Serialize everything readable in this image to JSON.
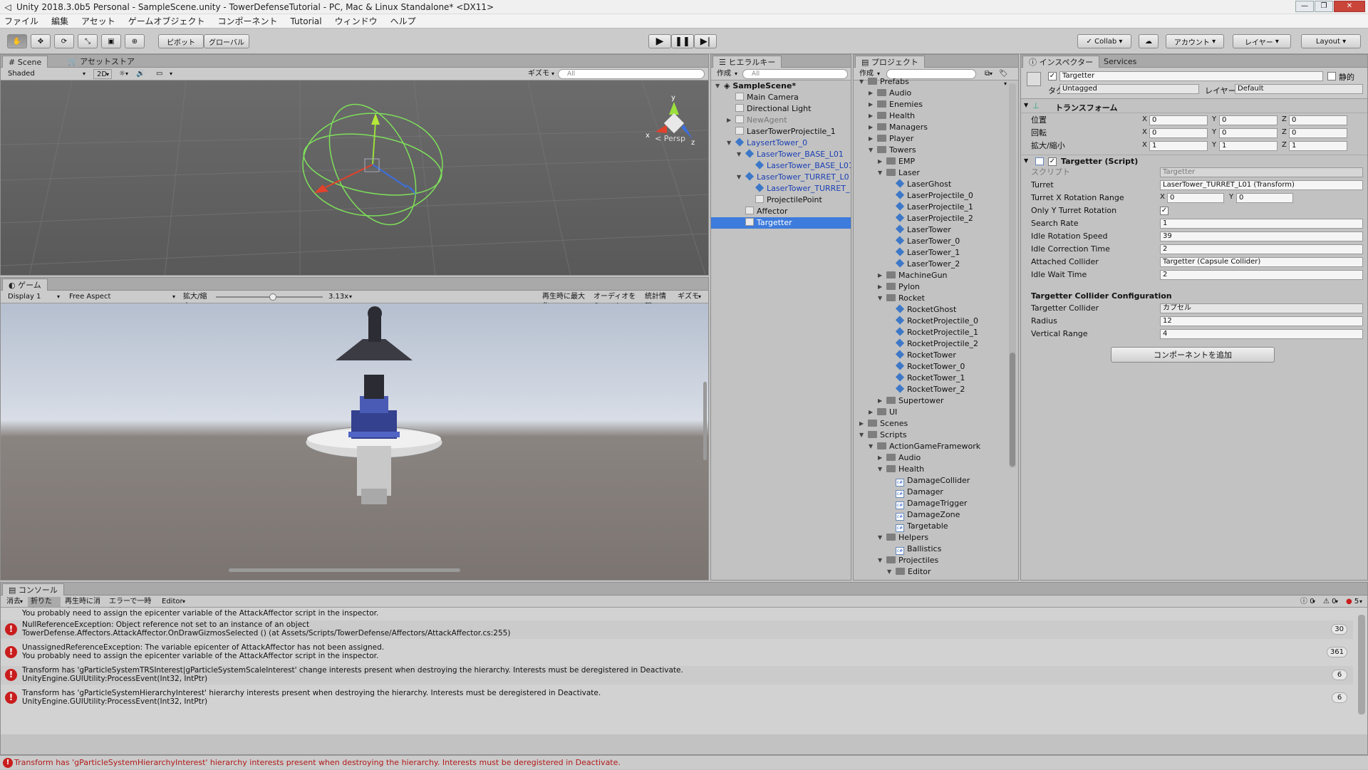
{
  "window": {
    "title": "Unity 2018.3.0b5 Personal - SampleScene.unity - TowerDefenseTutorial - PC, Mac & Linux Standalone* <DX11>"
  },
  "menu": [
    "ファイル",
    "編集",
    "アセット",
    "ゲームオブジェクト",
    "コンポーネント",
    "Tutorial",
    "ウィンドウ",
    "ヘルプ"
  ],
  "toolbar": {
    "pivot": "ピボット",
    "global": "グローバル",
    "collab": "Collab",
    "account": "アカウント",
    "layers": "レイヤー",
    "layout": "Layout"
  },
  "scene": {
    "tab": "Scene",
    "tab2": "アセットストア",
    "shading": "Shaded",
    "mode2d": "2D",
    "gizmos": "ギズモ",
    "search": "All",
    "persp": "< Persp"
  },
  "game": {
    "tab": "ゲーム",
    "display": "Display 1",
    "aspect": "Free Aspect",
    "scale_label": "拡大/縮小",
    "scale_value": "3.13x",
    "scale_fraction": 0.53,
    "maximize": "再生時に最大化",
    "mute": "オーディオをミュート",
    "stats": "統計情報",
    "gizmos": "ギズモ"
  },
  "hierarchy": {
    "tab": "ヒエラルキー",
    "create": "作成",
    "search": "All",
    "scene": "SampleScene*",
    "items": [
      {
        "label": "Main Camera",
        "depth": 1,
        "icon": "go",
        "arrow": ""
      },
      {
        "label": "Directional Light",
        "depth": 1,
        "icon": "go",
        "arrow": ""
      },
      {
        "label": "NewAgent",
        "depth": 1,
        "icon": "go",
        "arrow": "▶",
        "dim": true
      },
      {
        "label": "LaserTowerProjectile_1",
        "depth": 1,
        "icon": "go",
        "arrow": ""
      },
      {
        "label": "LaysertTower_0",
        "depth": 1,
        "icon": "cube",
        "arrow": "▼",
        "prefab": true
      },
      {
        "label": "LaserTower_BASE_L01",
        "depth": 2,
        "icon": "cube",
        "arrow": "▼",
        "prefab": true
      },
      {
        "label": "LaserTower_BASE_L01",
        "depth": 3,
        "icon": "cube",
        "arrow": "",
        "prefab": true
      },
      {
        "label": "LaserTower_TURRET_L0",
        "depth": 2,
        "icon": "cube",
        "arrow": "▼",
        "prefab": true
      },
      {
        "label": "LaserTower_TURRET_",
        "depth": 3,
        "icon": "cube",
        "arrow": "",
        "prefab": true
      },
      {
        "label": "ProjectilePoint",
        "depth": 3,
        "icon": "go",
        "arrow": ""
      },
      {
        "label": "Affector",
        "depth": 2,
        "icon": "go",
        "arrow": ""
      },
      {
        "label": "Targetter",
        "depth": 2,
        "icon": "go",
        "arrow": "",
        "selected": true
      }
    ]
  },
  "project": {
    "tab": "プロジェクト",
    "create": "作成",
    "items": [
      {
        "label": "Prefabs",
        "depth": 0,
        "icon": "folder",
        "arrow": "▼"
      },
      {
        "label": "Audio",
        "depth": 1,
        "icon": "folder",
        "arrow": "▶"
      },
      {
        "label": "Enemies",
        "depth": 1,
        "icon": "folder",
        "arrow": "▶"
      },
      {
        "label": "Health",
        "depth": 1,
        "icon": "folder",
        "arrow": "▶"
      },
      {
        "label": "Managers",
        "depth": 1,
        "icon": "folder",
        "arrow": "▶"
      },
      {
        "label": "Player",
        "depth": 1,
        "icon": "folder",
        "arrow": "▶"
      },
      {
        "label": "Towers",
        "depth": 1,
        "icon": "folder",
        "arrow": "▼"
      },
      {
        "label": "EMP",
        "depth": 2,
        "icon": "folder",
        "arrow": "▶"
      },
      {
        "label": "Laser",
        "depth": 2,
        "icon": "folder",
        "arrow": "▼"
      },
      {
        "label": "LaserGhost",
        "depth": 3,
        "icon": "cube",
        "arrow": ""
      },
      {
        "label": "LaserProjectile_0",
        "depth": 3,
        "icon": "cube",
        "arrow": ""
      },
      {
        "label": "LaserProjectile_1",
        "depth": 3,
        "icon": "cube",
        "arrow": ""
      },
      {
        "label": "LaserProjectile_2",
        "depth": 3,
        "icon": "cube",
        "arrow": ""
      },
      {
        "label": "LaserTower",
        "depth": 3,
        "icon": "cube",
        "arrow": ""
      },
      {
        "label": "LaserTower_0",
        "depth": 3,
        "icon": "cube",
        "arrow": ""
      },
      {
        "label": "LaserTower_1",
        "depth": 3,
        "icon": "cube",
        "arrow": ""
      },
      {
        "label": "LaserTower_2",
        "depth": 3,
        "icon": "cube",
        "arrow": ""
      },
      {
        "label": "MachineGun",
        "depth": 2,
        "icon": "folder",
        "arrow": "▶"
      },
      {
        "label": "Pylon",
        "depth": 2,
        "icon": "folder",
        "arrow": "▶"
      },
      {
        "label": "Rocket",
        "depth": 2,
        "icon": "folder",
        "arrow": "▼"
      },
      {
        "label": "RocketGhost",
        "depth": 3,
        "icon": "cube",
        "arrow": ""
      },
      {
        "label": "RocketProjectile_0",
        "depth": 3,
        "icon": "cube",
        "arrow": ""
      },
      {
        "label": "RocketProjectile_1",
        "depth": 3,
        "icon": "cube",
        "arrow": ""
      },
      {
        "label": "RocketProjectile_2",
        "depth": 3,
        "icon": "cube",
        "arrow": ""
      },
      {
        "label": "RocketTower",
        "depth": 3,
        "icon": "cube",
        "arrow": ""
      },
      {
        "label": "RocketTower_0",
        "depth": 3,
        "icon": "cube",
        "arrow": ""
      },
      {
        "label": "RocketTower_1",
        "depth": 3,
        "icon": "cube",
        "arrow": ""
      },
      {
        "label": "RocketTower_2",
        "depth": 3,
        "icon": "cube",
        "arrow": ""
      },
      {
        "label": "Supertower",
        "depth": 2,
        "icon": "folder",
        "arrow": "▶"
      },
      {
        "label": "UI",
        "depth": 1,
        "icon": "folder",
        "arrow": "▶"
      },
      {
        "label": "Scenes",
        "depth": 0,
        "icon": "folder",
        "arrow": "▶"
      },
      {
        "label": "Scripts",
        "depth": 0,
        "icon": "folder",
        "arrow": "▼"
      },
      {
        "label": "ActionGameFramework",
        "depth": 1,
        "icon": "folder",
        "arrow": "▼"
      },
      {
        "label": "Audio",
        "depth": 2,
        "icon": "folder",
        "arrow": "▶"
      },
      {
        "label": "Health",
        "depth": 2,
        "icon": "folder",
        "arrow": "▼"
      },
      {
        "label": "DamageCollider",
        "depth": 3,
        "icon": "cs",
        "arrow": ""
      },
      {
        "label": "Damager",
        "depth": 3,
        "icon": "cs",
        "arrow": ""
      },
      {
        "label": "DamageTrigger",
        "depth": 3,
        "icon": "cs",
        "arrow": ""
      },
      {
        "label": "DamageZone",
        "depth": 3,
        "icon": "cs",
        "arrow": ""
      },
      {
        "label": "Targetable",
        "depth": 3,
        "icon": "cs",
        "arrow": ""
      },
      {
        "label": "Helpers",
        "depth": 2,
        "icon": "folder",
        "arrow": "▼"
      },
      {
        "label": "Ballistics",
        "depth": 3,
        "icon": "cs",
        "arrow": ""
      },
      {
        "label": "Projectiles",
        "depth": 2,
        "icon": "folder",
        "arrow": "▼"
      },
      {
        "label": "Editor",
        "depth": 3,
        "icon": "folder",
        "arrow": "▼"
      }
    ]
  },
  "inspector": {
    "tab": "インスペクター",
    "tab2": "Services",
    "name": "Targetter",
    "static": "静的",
    "tag_label": "タグ",
    "tag": "Untagged",
    "layer_label": "レイヤー",
    "layer": "Default",
    "transform": "トランスフォーム",
    "transform_rows": [
      {
        "label": "位置",
        "x": "0",
        "y": "0",
        "z": "0"
      },
      {
        "label": "回転",
        "x": "0",
        "y": "0",
        "z": "0"
      },
      {
        "label": "拡大/縮小",
        "x": "1",
        "y": "1",
        "z": "1"
      }
    ],
    "script_title": "Targetter (Script)",
    "script_label": "スクリプト",
    "script_value": "Targetter",
    "props": [
      {
        "label": "Turret",
        "value": "LaserTower_TURRET_L01 (Transform)"
      },
      {
        "label": "Turret X Rotation Range",
        "x": "0",
        "y": "0"
      },
      {
        "label": "Only Y Turret Rotation",
        "check": true
      },
      {
        "label": "Search Rate",
        "value": "1"
      },
      {
        "label": "Idle Rotation Speed",
        "value": "39"
      },
      {
        "label": "Idle Correction Time",
        "value": "2"
      },
      {
        "label": "Attached Collider",
        "value": "Targetter (Capsule Collider)"
      },
      {
        "label": "Idle Wait Time",
        "value": "2"
      }
    ],
    "collider_header": "Targetter Collider Configuration",
    "collider_props": [
      {
        "label": "Targetter Collider",
        "value": "カプセル"
      },
      {
        "label": "Radius",
        "value": "12"
      },
      {
        "label": "Vertical Range",
        "value": "4"
      }
    ],
    "add_component": "コンポーネントを追加"
  },
  "console": {
    "tab": "コンソール",
    "clear": "消去",
    "collapse": "折りたたみ",
    "clear_on_play": "再生時に消去",
    "error_pause": "エラーで一時停止",
    "editor": "Editor",
    "count_info": "0",
    "count_warn": "0",
    "count_err": "5",
    "partial": "You probably need to assign the epicenter variable of the AttackAffector script in the inspector.",
    "rows": [
      {
        "l1": "NullReferenceException: Object reference not set to an instance of an object",
        "l2": "TowerDefense.Affectors.AttackAffector.OnDrawGizmosSelected () (at Assets/Scripts/TowerDefense/Affectors/AttackAffector.cs:255)",
        "count": "30"
      },
      {
        "l1": "UnassignedReferenceException: The variable epicenter of AttackAffector has not been assigned.",
        "l2": "You probably need to assign the epicenter variable of the AttackAffector script in the inspector.",
        "count": "361"
      },
      {
        "l1": "Transform has 'gParticleSystemTRSInterest|gParticleSystemScaleInterest' change interests present when destroying the hierarchy. Interests must be deregistered in Deactivate.",
        "l2": "UnityEngine.GUIUtility:ProcessEvent(Int32, IntPtr)",
        "count": "6"
      },
      {
        "l1": "Transform has 'gParticleSystemHierarchyInterest' hierarchy interests present when destroying the hierarchy. Interests must be deregistered in Deactivate.",
        "l2": "UnityEngine.GUIUtility:ProcessEvent(Int32, IntPtr)",
        "count": "6"
      }
    ]
  },
  "status": "Transform has 'gParticleSystemHierarchyInterest' hierarchy interests present when destroying the hierarchy. Interests must be deregistered in Deactivate."
}
